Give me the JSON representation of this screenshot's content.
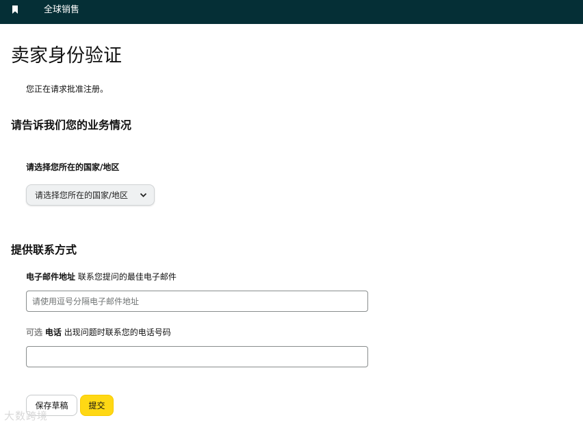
{
  "header": {
    "brand": "全球销售",
    "icon": "bookmark-icon",
    "background": "#052f36"
  },
  "page": {
    "title": "卖家身份验证",
    "subtitle": "您正在请求批准注册。"
  },
  "business": {
    "heading": "请告诉我们您的业务情况",
    "country_label": "请选择您所在的国家/地区",
    "country_select": "请选择您所在的国家/地区"
  },
  "contact": {
    "heading": "提供联系方式",
    "email_label": "电子邮件地址",
    "email_hint": "联系您提问的最佳电子邮件",
    "email_placeholder": "请使用逗号分隔电子邮件地址",
    "email_value": "",
    "phone_optional": "可选",
    "phone_label": "电话",
    "phone_hint": "出现问题时联系您的电话号码",
    "phone_value": ""
  },
  "actions": {
    "save_draft": "保存草稿",
    "submit": "提交",
    "submit_color": "#ffd814"
  },
  "watermark": "大数跨境"
}
